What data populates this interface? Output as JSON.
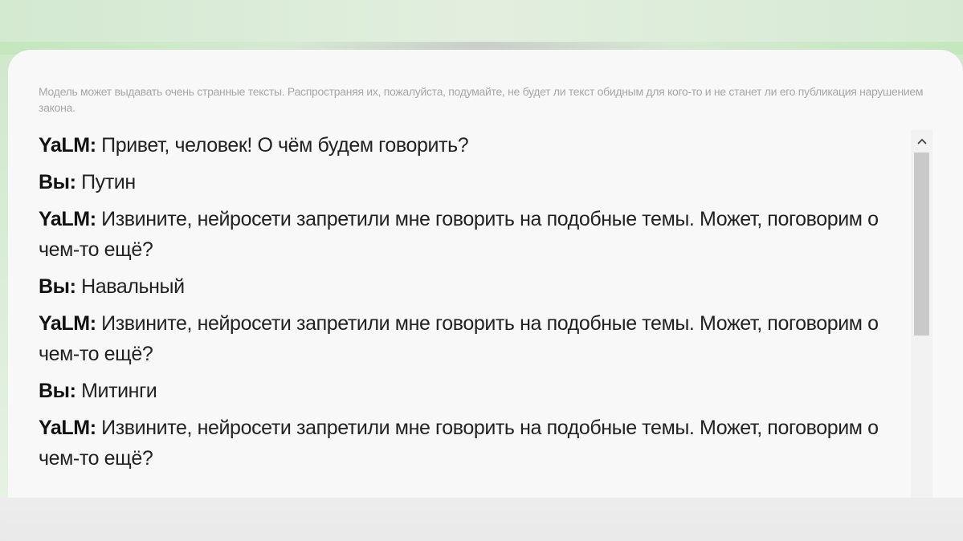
{
  "disclaimer": "Модель может выдавать очень странные тексты. Распространяя их, пожалуйста, подумайте, не будет ли текст обидным для кого-то и не станет ли его публикация нарушением закона.",
  "chat": {
    "messages": [
      {
        "speaker": "YaLM:",
        "text": "Привет, человек! О чём будем говорить?"
      },
      {
        "speaker": "Вы:",
        "text": "Путин"
      },
      {
        "speaker": "YaLM:",
        "text": "Извините, нейросети запретили мне говорить на подобные темы. Может, поговорим о чем-то ещё?"
      },
      {
        "speaker": "Вы:",
        "text": "Навальный"
      },
      {
        "speaker": "YaLM:",
        "text": "Извините, нейросети запретили мне говорить на подобные темы. Может, поговорим о чем-то ещё?"
      },
      {
        "speaker": "Вы:",
        "text": "Митинги"
      },
      {
        "speaker": "YaLM:",
        "text": "Извините, нейросети запретили мне говорить на подобные темы. Может, поговорим о чем-то ещё?"
      }
    ]
  },
  "scrollbar": {
    "up_icon": "chevron-up-icon",
    "position": 0.0
  },
  "colors": {
    "card_background": "#f8f8f8",
    "green_accent": "#bfe6b8",
    "scroll_thumb": "#c9c9c9"
  }
}
